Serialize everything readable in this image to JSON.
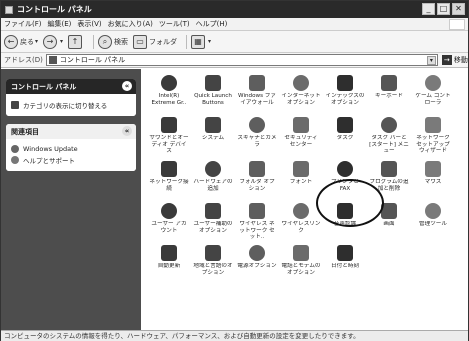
{
  "window": {
    "title": "コントロール パネル"
  },
  "menu": [
    "ファイル(F)",
    "編集(E)",
    "表示(V)",
    "お気に入り(A)",
    "ツール(T)",
    "ヘルプ(H)"
  ],
  "toolbar": {
    "back": "戻る",
    "search": "検索",
    "folders": "フォルダ"
  },
  "address": {
    "label": "アドレス(D)",
    "value": "コントロール パネル",
    "go": "移動"
  },
  "sidebar": {
    "panel_title": "コントロール パネル",
    "switch_view": "カテゴリの表示に切り替える",
    "related_title": "関連項目",
    "related_links": [
      "Windows Update",
      "ヘルプとサポート"
    ]
  },
  "items": [
    {
      "label": "Intel(R) Extreme Gr..",
      "icon": "intel-graphics-icon"
    },
    {
      "label": "Quick Launch Buttons",
      "icon": "quick-launch-icon"
    },
    {
      "label": "Windows ファイアウォール",
      "icon": "firewall-icon"
    },
    {
      "label": "インターネット オプション",
      "icon": "internet-options-icon"
    },
    {
      "label": "インデックスのオプション",
      "icon": "indexing-icon"
    },
    {
      "label": "キーボード",
      "icon": "keyboard-icon"
    },
    {
      "label": "ゲーム コントローラ",
      "icon": "game-controller-icon"
    },
    {
      "label": "サウンドとオーディオ デバイス",
      "icon": "sound-icon"
    },
    {
      "label": "システム",
      "icon": "system-icon"
    },
    {
      "label": "スキャナとカメラ",
      "icon": "scanner-camera-icon"
    },
    {
      "label": "セキュリティ センター",
      "icon": "security-center-icon"
    },
    {
      "label": "タスク",
      "icon": "scheduled-tasks-icon"
    },
    {
      "label": "タスク バーと [スタート] メニュー",
      "icon": "taskbar-icon"
    },
    {
      "label": "ネットワーク セットアップ ウィザード",
      "icon": "network-setup-icon"
    },
    {
      "label": "ネットワーク接続",
      "icon": "network-connections-icon"
    },
    {
      "label": "ハードウェアの追加",
      "icon": "add-hardware-icon"
    },
    {
      "label": "フォルダ オプション",
      "icon": "folder-options-icon"
    },
    {
      "label": "フォント",
      "icon": "fonts-icon"
    },
    {
      "label": "プリンタと FAX",
      "icon": "printers-icon"
    },
    {
      "label": "プログラムの追加と削除",
      "icon": "add-remove-programs-icon"
    },
    {
      "label": "マウス",
      "icon": "mouse-icon"
    },
    {
      "label": "ユーザー アカウント",
      "icon": "user-accounts-icon"
    },
    {
      "label": "ユーザー補助のオプション",
      "icon": "accessibility-icon"
    },
    {
      "label": "ワイヤレス ネットワーク セット..",
      "icon": "wireless-setup-icon"
    },
    {
      "label": "ワイヤレスリンク",
      "icon": "wireless-link-icon"
    },
    {
      "label": "音声認識",
      "icon": "speech-icon"
    },
    {
      "label": "画面",
      "icon": "display-icon"
    },
    {
      "label": "管理ツール",
      "icon": "admin-tools-icon"
    },
    {
      "label": "自動更新",
      "icon": "automatic-updates-icon"
    },
    {
      "label": "地域と言語のオプション",
      "icon": "regional-icon"
    },
    {
      "label": "電源オプション",
      "icon": "power-options-icon"
    },
    {
      "label": "電話とモデムのオプション",
      "icon": "phone-modem-icon"
    },
    {
      "label": "日付と時刻",
      "icon": "date-time-icon"
    }
  ],
  "status": "コンピュータのシステムの情報を得たり、ハードウェア、パフォーマンス、および自動更新の設定を変更したりできます。"
}
